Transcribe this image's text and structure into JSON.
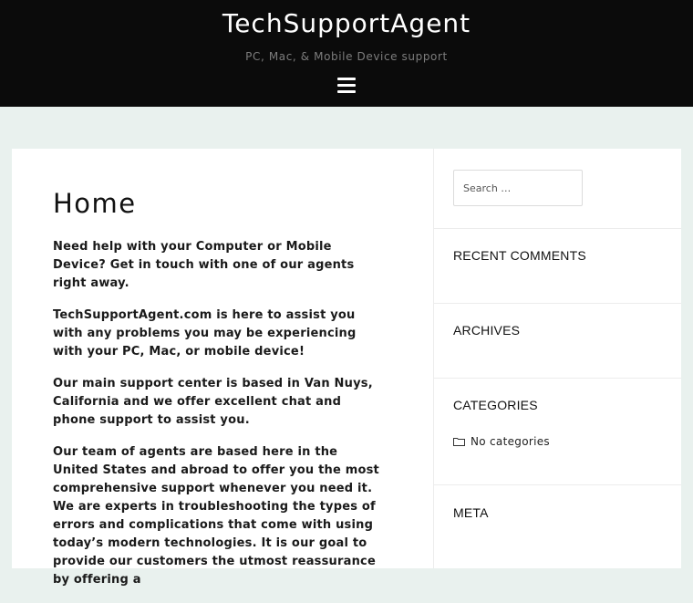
{
  "site": {
    "title": "TechSupportAgent",
    "tagline": "PC, Mac, & Mobile Device support"
  },
  "page": {
    "title": "Home",
    "paragraphs": [
      "Need help with your Computer or Mobile Device? Get in touch with one of our agents right away.",
      "TechSupportAgent.com is here to assist you with any problems you may be experiencing with your PC, Mac, or mobile device!",
      "Our main support center is based in Van Nuys, California and we offer excellent chat and phone support to assist you.",
      "Our team of agents are based here in the United States and abroad to offer you the most comprehensive support whenever you need it. We are experts in troubleshooting the types of errors and complications that come with using today’s modern technologies. It is our goal to provide our customers the utmost reassurance by offering a"
    ]
  },
  "sidebar": {
    "search_placeholder": "Search …",
    "recent_comments": "RECENT COMMENTS",
    "archives": "ARCHIVES",
    "categories": "CATEGORIES",
    "no_categories": "No categories",
    "meta": "META"
  },
  "colors": {
    "header_bg": "#0b0b0b",
    "page_bg": "#e9f1ee",
    "card_bg": "#ffffff"
  },
  "icons": {
    "menu": "hamburger-menu-icon",
    "category": "folder-icon"
  }
}
